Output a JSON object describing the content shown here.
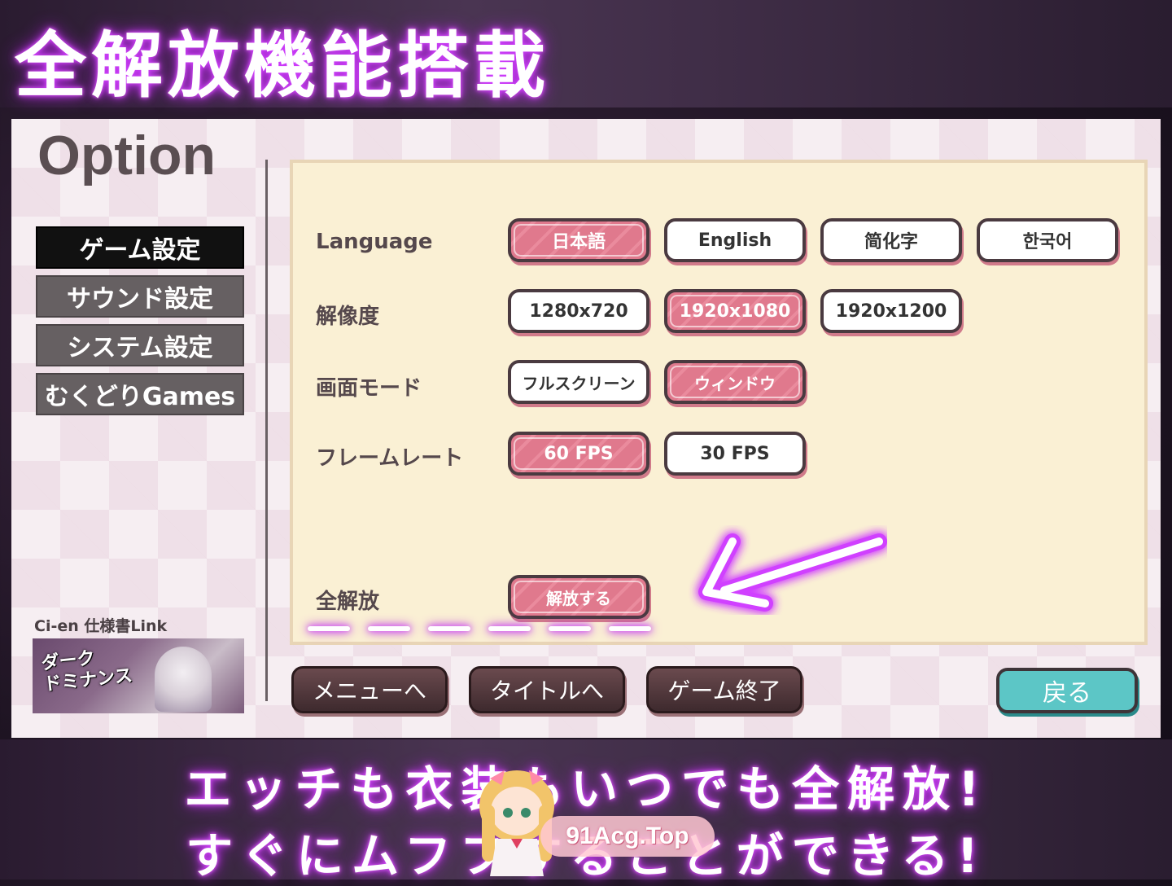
{
  "banner": {
    "title": "全解放機能搭載"
  },
  "screen": {
    "title": "Option",
    "side_menu": [
      {
        "label": "ゲーム設定",
        "active": true
      },
      {
        "label": "サウンド設定",
        "active": false
      },
      {
        "label": "システム設定",
        "active": false
      },
      {
        "label": "むくどりGames",
        "active": false
      }
    ],
    "cien_label": "Ci-en 仕様書Link",
    "banner_image_text": "ダーク\nドミナンス",
    "settings": {
      "language": {
        "label": "Language",
        "options": [
          "日本語",
          "English",
          "简化字",
          "한국어"
        ],
        "selected": "日本語"
      },
      "resolution": {
        "label": "解像度",
        "options": [
          "1280x720",
          "1920x1080",
          "1920x1200"
        ],
        "selected": "1920x1080"
      },
      "screen_mode": {
        "label": "画面モード",
        "options": [
          "フルスクリーン",
          "ウィンドウ"
        ],
        "selected": "ウィンドウ"
      },
      "frame_rate": {
        "label": "フレームレート",
        "options": [
          "60 FPS",
          "30 FPS"
        ],
        "selected": "60 FPS"
      },
      "unlock_all": {
        "label": "全解放",
        "button": "解放する"
      }
    },
    "bottom_buttons": {
      "menu": "メニューへ",
      "title": "タイトルへ",
      "quit": "ゲーム終了",
      "back": "戻る"
    }
  },
  "captions": {
    "line1": "エッチも衣装もいつでも全解放!",
    "line2": "すぐにムフフすることができる!"
  },
  "watermark": {
    "text": "91Acg.Top"
  },
  "colors": {
    "accent_pink": "#e0798d",
    "back_teal": "#5cc6c6",
    "glow_purple": "#d040ff"
  }
}
